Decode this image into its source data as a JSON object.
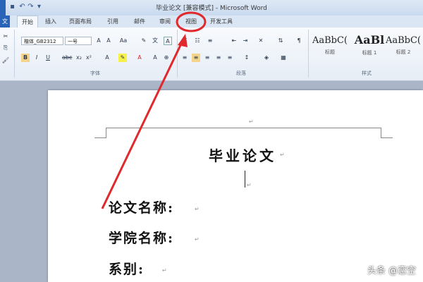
{
  "window": {
    "title": "毕业论文 [兼容模式] - Microsoft Word"
  },
  "tabs": [
    {
      "label": "文件"
    },
    {
      "label": "开始"
    },
    {
      "label": "插入"
    },
    {
      "label": "页面布局"
    },
    {
      "label": "引用"
    },
    {
      "label": "邮件"
    },
    {
      "label": "审阅"
    },
    {
      "label": "视图"
    },
    {
      "label": "开发工具"
    }
  ],
  "ribbon": {
    "font_name": "楷体_GB2312",
    "font_size": "一号",
    "style_cards": [
      {
        "sample": "AaBbC(",
        "name": "标题"
      },
      {
        "sample": "AaBl",
        "name": "标题 1"
      },
      {
        "sample": "AaBbC(",
        "name": "标题 2"
      }
    ],
    "groups": [
      {
        "label": "字体"
      },
      {
        "label": "段落"
      },
      {
        "label": "样式"
      }
    ]
  },
  "document": {
    "title": "毕业论文",
    "lines": [
      {
        "label": "论文名称:"
      },
      {
        "label": "学院名称:"
      },
      {
        "label": "系别:"
      }
    ],
    "paragraph_mark": "↵"
  },
  "annotation": {
    "color": "#e0292c"
  },
  "watermark": "头条 @恋空"
}
